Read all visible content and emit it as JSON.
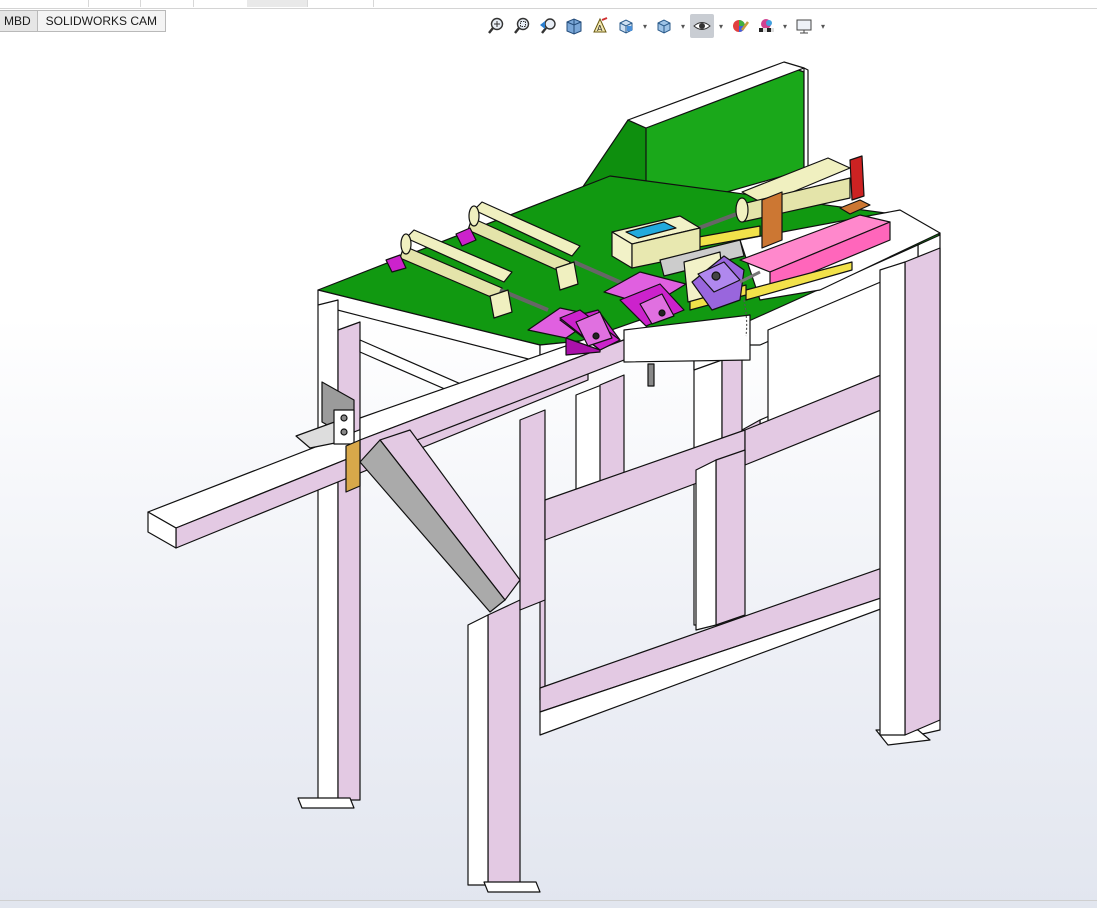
{
  "command_manager": {
    "tabs": [
      {
        "label": "MBD",
        "active": false
      },
      {
        "label": "SOLIDWORKS CAM",
        "active": true
      }
    ]
  },
  "heads_up_toolbar": {
    "tools": [
      {
        "icon": "zoom-to-fit-icon"
      },
      {
        "icon": "zoom-to-area-icon"
      },
      {
        "icon": "previous-view-icon"
      },
      {
        "icon": "section-view-icon"
      },
      {
        "icon": "dynamic-annotation-views-icon"
      },
      {
        "icon": "view-orientation-icon",
        "dropdown": true
      },
      {
        "icon": "display-style-icon",
        "dropdown": true
      },
      {
        "icon": "hide-show-items-icon",
        "dropdown": true,
        "pressed": true
      },
      {
        "icon": "edit-appearance-icon"
      },
      {
        "icon": "apply-scene-icon",
        "dropdown": true
      },
      {
        "icon": "view-settings-icon",
        "dropdown": true
      }
    ]
  },
  "viewport": {
    "model": "assembly-isometric",
    "colors": {
      "frame": "#e3c9e3",
      "frame_light": "#ffffff",
      "table_top": "#119911",
      "backplate": "#1aa81a",
      "cylinder": "#f0f0c0",
      "bracket": "#cc22cc",
      "bracket_light": "#e060e0",
      "belt": "#ff88cc",
      "rail": "#f2e24a",
      "slider": "#f2f2c8",
      "slider_blue": "#22aadd",
      "clamp": "#9966dd",
      "clamp_orange": "#cc7733",
      "edge": "#111111"
    }
  }
}
